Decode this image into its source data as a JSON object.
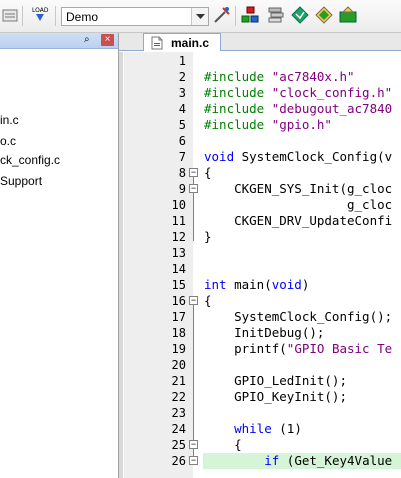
{
  "toolbar": {
    "target_name": "Demo",
    "icons": [
      "project-icon",
      "load-icon",
      "target-options-icon",
      "manage-components-icon",
      "rte-icon",
      "select-packs-icon",
      "pack-installer-icon"
    ]
  },
  "project_panel": {
    "pin_glyph": "⌕",
    "close_glyph": "×",
    "items": [
      "in.c",
      "o.c",
      "ck_config.c",
      "Support"
    ]
  },
  "editor": {
    "tab_label": "main.c",
    "lines": [
      {
        "n": "1",
        "segments": []
      },
      {
        "n": "2",
        "segments": [
          {
            "t": "#include ",
            "c": "pp"
          },
          {
            "t": "\"ac7840x.h\"",
            "c": "str"
          }
        ]
      },
      {
        "n": "3",
        "segments": [
          {
            "t": "#include ",
            "c": "pp"
          },
          {
            "t": "\"clock_config.h\"",
            "c": "str"
          }
        ]
      },
      {
        "n": "4",
        "segments": [
          {
            "t": "#include ",
            "c": "pp"
          },
          {
            "t": "\"debugout_ac7840",
            "c": "str"
          }
        ]
      },
      {
        "n": "5",
        "segments": [
          {
            "t": "#include ",
            "c": "pp"
          },
          {
            "t": "\"gpio.h\"",
            "c": "str"
          }
        ]
      },
      {
        "n": "6",
        "segments": []
      },
      {
        "n": "7",
        "segments": [
          {
            "t": "void",
            "c": "kw"
          },
          {
            "t": " SystemClock_Config(v",
            "c": ""
          }
        ]
      },
      {
        "n": "8",
        "segments": [
          {
            "t": "{",
            "c": ""
          }
        ]
      },
      {
        "n": "9",
        "segments": [
          {
            "t": "    CKGEN_SYS_Init(g_cloc",
            "c": ""
          }
        ]
      },
      {
        "n": "10",
        "segments": [
          {
            "t": "                   g_cloc",
            "c": ""
          }
        ]
      },
      {
        "n": "11",
        "segments": [
          {
            "t": "    CKGEN_DRV_UpdateConfi",
            "c": ""
          }
        ]
      },
      {
        "n": "12",
        "segments": [
          {
            "t": "}",
            "c": ""
          }
        ]
      },
      {
        "n": "13",
        "segments": []
      },
      {
        "n": "14",
        "segments": []
      },
      {
        "n": "15",
        "segments": [
          {
            "t": "int",
            "c": "kw"
          },
          {
            "t": " main(",
            "c": ""
          },
          {
            "t": "void",
            "c": "kw"
          },
          {
            "t": ")",
            "c": ""
          }
        ]
      },
      {
        "n": "16",
        "segments": [
          {
            "t": "{",
            "c": ""
          }
        ]
      },
      {
        "n": "17",
        "segments": [
          {
            "t": "    SystemClock_Config();",
            "c": ""
          }
        ]
      },
      {
        "n": "18",
        "segments": [
          {
            "t": "    InitDebug();",
            "c": ""
          }
        ]
      },
      {
        "n": "19",
        "segments": [
          {
            "t": "    printf(",
            "c": ""
          },
          {
            "t": "\"GPIO Basic Te",
            "c": "str"
          }
        ]
      },
      {
        "n": "20",
        "segments": []
      },
      {
        "n": "21",
        "segments": [
          {
            "t": "    GPIO_LedInit();",
            "c": ""
          }
        ]
      },
      {
        "n": "22",
        "segments": [
          {
            "t": "    GPIO_KeyInit();",
            "c": ""
          }
        ]
      },
      {
        "n": "23",
        "segments": []
      },
      {
        "n": "24",
        "segments": [
          {
            "t": "    ",
            "c": ""
          },
          {
            "t": "while",
            "c": "kw"
          },
          {
            "t": " (1)",
            "c": ""
          }
        ]
      },
      {
        "n": "25",
        "segments": [
          {
            "t": "    {",
            "c": ""
          }
        ]
      },
      {
        "n": "26",
        "segments": [
          {
            "t": "        ",
            "c": ""
          },
          {
            "t": "if",
            "c": "kw"
          },
          {
            "t": " (Get_Key4Value",
            "c": ""
          }
        ]
      }
    ]
  }
}
